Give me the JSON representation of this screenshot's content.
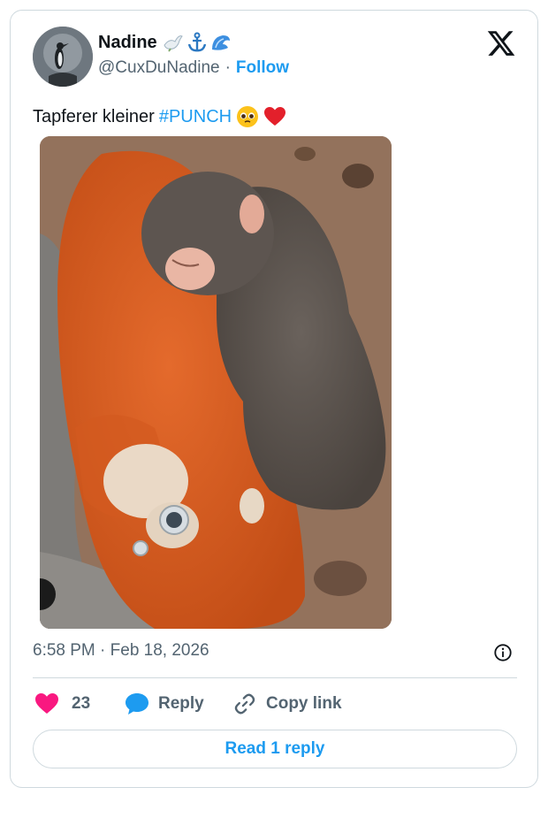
{
  "author": {
    "name": "Nadine",
    "handle": "@CuxDuNadine",
    "separator": "·",
    "follow_label": "Follow",
    "emojis": [
      "dove-icon",
      "anchor-icon",
      "wave-icon"
    ]
  },
  "tweet": {
    "text": "Tapferer kleiner",
    "hashtag": "#PUNCH",
    "emojis": [
      "pleading-face-icon",
      "red-heart-icon"
    ],
    "media_description_icon": "baby-monkey-hugging-orange-plush-toy"
  },
  "meta": {
    "timestamp": "6:58 PM · Feb 18, 2026"
  },
  "actions": {
    "like_count": "23",
    "reply_label": "Reply",
    "copy_link_label": "Copy link"
  },
  "footer": {
    "read_replies_label": "Read 1 reply"
  },
  "colors": {
    "accent": "#1d9bf0",
    "like": "#f91880",
    "text": "#0f1419",
    "muted": "#536471",
    "border": "#cfd9de"
  }
}
